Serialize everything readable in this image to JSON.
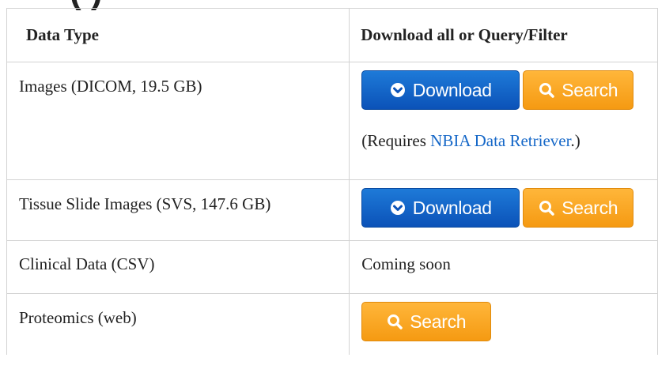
{
  "heading_fragment": "(               )",
  "table": {
    "headers": [
      "Data Type",
      "Download all or Query/Filter"
    ],
    "rows": [
      {
        "label": "Images (DICOM, 19.5 GB)",
        "download": "Download",
        "search": "Search",
        "note_prefix": "(Requires ",
        "note_link": "NBIA Data Retriever",
        "note_suffix": ".)"
      },
      {
        "label": "Tissue Slide Images (SVS, 147.6 GB)",
        "download": "Download",
        "search": "Search"
      },
      {
        "label": "Clinical Data (CSV)",
        "status": "Coming soon"
      },
      {
        "label": "Proteomics (web)",
        "search": "Search"
      }
    ]
  },
  "icons": {
    "download": "download-circle-icon",
    "search": "search-icon"
  },
  "colors": {
    "download": "#0b52b8",
    "search": "#f59a12",
    "link": "#1668c8",
    "border": "#d3d3d3"
  }
}
